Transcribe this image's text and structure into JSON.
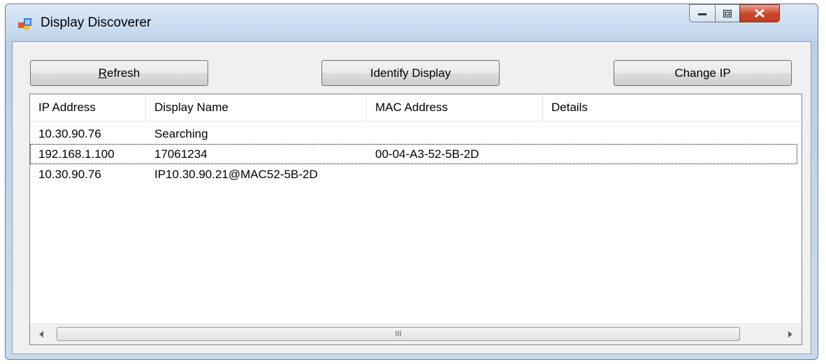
{
  "window": {
    "title": "Display Discoverer",
    "controls": {
      "minimize_icon": "minimize-icon",
      "maximize_icon": "maximize-icon",
      "close_label": "X"
    }
  },
  "toolbar": {
    "refresh_label": "Refresh",
    "identify_label": "Identify Display",
    "change_ip_label": "Change IP"
  },
  "table": {
    "columns": [
      "IP Address",
      "Display Name",
      "MAC Address",
      "Details"
    ],
    "rows": [
      [
        "10.30.90.76",
        "Searching",
        "",
        ""
      ],
      [
        "192.168.1.100",
        "17061234",
        "00-04-A3-52-5B-2D",
        ""
      ],
      [
        "10.30.90.76",
        "IP10.30.90.21@MAC52-5B-2D",
        "",
        ""
      ]
    ],
    "focused_row": 1
  },
  "scrollbar": {
    "thumb_grip": "III"
  },
  "colors": {
    "window_frame": "#c6d9ee",
    "client_bg": "#f0f0f0",
    "close_button": "#c8452b"
  }
}
